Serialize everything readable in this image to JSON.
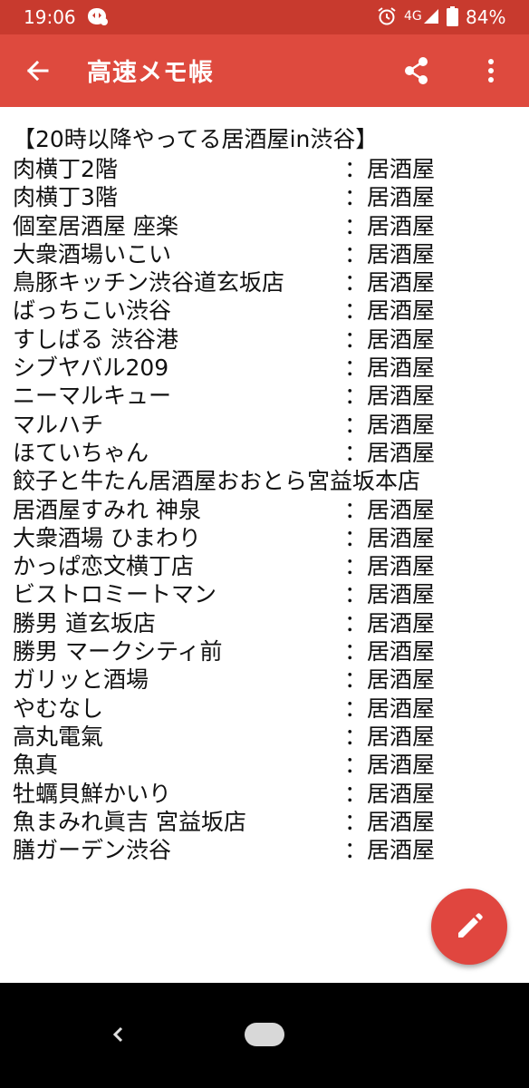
{
  "status_bar": {
    "time": "19:06",
    "network": "4G",
    "battery": "84%",
    "icons": [
      "app-notification-icon",
      "alarm-icon",
      "signal-icon",
      "battery-icon"
    ]
  },
  "app_bar": {
    "title": "高速メモ帳",
    "icons": [
      "back-arrow-icon",
      "share-icon",
      "more-vert-icon"
    ]
  },
  "memo": {
    "title": "【20時以降やってる居酒屋in渋谷】",
    "items": [
      {
        "name": "肉横丁2階",
        "category": "：居酒屋"
      },
      {
        "name": "肉横丁3階",
        "category": "：居酒屋"
      },
      {
        "name": "個室居酒屋 座楽",
        "category": "：居酒屋"
      },
      {
        "name": "大衆酒場いこい",
        "category": "：居酒屋"
      },
      {
        "name": "鳥豚キッチン渋谷道玄坂店",
        "category": "：居酒屋"
      },
      {
        "name": "ばっちこい渋谷",
        "category": "：居酒屋"
      },
      {
        "name": "すしばる 渋谷港",
        "category": "：居酒屋"
      },
      {
        "name": "シブヤバル209",
        "category": "：居酒屋"
      },
      {
        "name": "ニーマルキュー",
        "category": "：居酒屋"
      },
      {
        "name": "マルハチ",
        "category": "：居酒屋"
      },
      {
        "name": "ほていちゃん",
        "category": "：居酒屋"
      },
      {
        "name": "餃子と牛たん居酒屋おおとら宮益坂本店",
        "category": ""
      },
      {
        "name": "居酒屋すみれ 神泉",
        "category": "：居酒屋"
      },
      {
        "name": "大衆酒場 ひまわり",
        "category": "：居酒屋"
      },
      {
        "name": "かっぱ恋文横丁店",
        "category": "：居酒屋"
      },
      {
        "name": "ビストロミートマン",
        "category": "：居酒屋"
      },
      {
        "name": "勝男 道玄坂店",
        "category": "：居酒屋"
      },
      {
        "name": "勝男 マークシティ前",
        "category": "：居酒屋"
      },
      {
        "name": "ガリッと酒場",
        "category": "：居酒屋"
      },
      {
        "name": "やむなし",
        "category": "：居酒屋"
      },
      {
        "name": "高丸電氣",
        "category": "：居酒屋"
      },
      {
        "name": "魚真",
        "category": "：居酒屋"
      },
      {
        "name": "牡蠣貝鮮かいり",
        "category": "：居酒屋"
      },
      {
        "name": "魚まみれ眞吉 宮益坂店",
        "category": "：居酒屋"
      },
      {
        "name": "膳ガーデン渋谷",
        "category": "：居酒屋"
      }
    ]
  },
  "fab": {
    "icon": "edit-pencil-icon"
  },
  "nav_bar": {
    "icons": [
      "nav-back-icon",
      "nav-home-pill"
    ]
  },
  "colors": {
    "status_bar": "#c83a2e",
    "app_bar": "#de4a3e",
    "fab": "#e0463f",
    "nav_bar": "#000000"
  }
}
